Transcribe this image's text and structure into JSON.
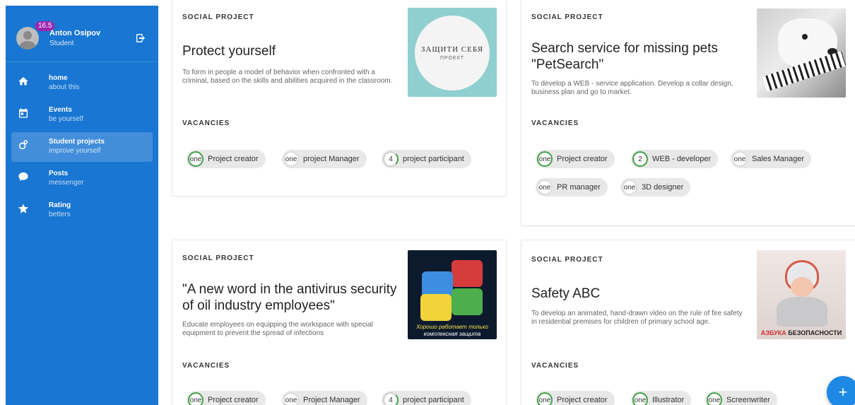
{
  "user": {
    "name": "Anton Osipov",
    "role": "Student",
    "badge": "16.5"
  },
  "nav": [
    {
      "title": "home",
      "sub": "about this",
      "icon": "home-icon"
    },
    {
      "title": "Events",
      "sub": "be yourself",
      "icon": "calendar-icon"
    },
    {
      "title": "Student projects",
      "sub": "improve yourself",
      "icon": "projects-icon",
      "active": true
    },
    {
      "title": "Posts",
      "sub": "messenger",
      "icon": "chat-icon"
    },
    {
      "title": "Rating",
      "sub": "betters",
      "icon": "star-icon"
    }
  ],
  "colors": {
    "sidebar": "#1976d2",
    "accent_green": "#43a047",
    "chip_bg": "#e8e8e8",
    "fab": "#1e88e5"
  },
  "vacancies_label": "VACANCIES",
  "projects": [
    {
      "kicker": "SOCIAL PROJECT",
      "title": "Protect yourself",
      "desc": "To form in people a model of behavior when confronted with a criminal, based on the skills and abilities acquired in the classroom.",
      "image_text": [
        "ЗАЩИТИ СЕБЯ",
        "ПРОЕКТ"
      ],
      "chips": [
        {
          "count": "one",
          "label": "Project creator"
        },
        {
          "count": "one",
          "label": "project Manager"
        },
        {
          "count": "4",
          "label": "project participant"
        }
      ]
    },
    {
      "kicker": "SOCIAL PROJECT",
      "title": "Search service for missing pets \"PetSearch\"",
      "desc": "To develop a WEB - service application. Develop a collar design, business plan and go to market.",
      "chips": [
        {
          "count": "one",
          "label": "Project creator"
        },
        {
          "count": "2",
          "label": "WEB - developer"
        },
        {
          "count": "one",
          "label": "Sales Manager"
        },
        {
          "count": "one",
          "label": "PR manager"
        },
        {
          "count": "one",
          "label": "3D designer"
        }
      ]
    },
    {
      "kicker": "SOCIAL PROJECT",
      "title": "\"A new word in the antivirus security of oil industry employees\"",
      "desc": "Educate employees on equipping the workspace with special equipment to prevent the spread of infections",
      "image_text": [
        "Хорошо работает только",
        "комплексная защита"
      ],
      "chips": [
        {
          "count": "one",
          "label": "Project creator"
        },
        {
          "count": "one",
          "label": "Project Manager"
        },
        {
          "count": "4",
          "label": "project participant"
        }
      ]
    },
    {
      "kicker": "SOCIAL PROJECT",
      "title": "Safety ABC",
      "desc": "To develop an animated, hand-drawn video on the rule of fire safety in residential premises for children of primary school age.",
      "image_text": [
        "АЗБУКА",
        "БЕЗОПАСНОСТИ"
      ],
      "chips": [
        {
          "count": "one",
          "label": "Project creator"
        },
        {
          "count": "one",
          "label": "Illustrator"
        },
        {
          "count": "one",
          "label": "Screenwriter"
        }
      ]
    }
  ],
  "fab_label": "+"
}
